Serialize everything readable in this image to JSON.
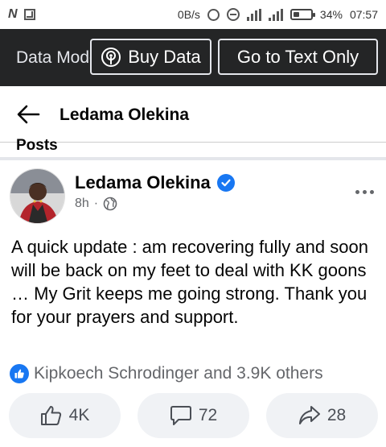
{
  "statusbar": {
    "speed": "0B/s",
    "battery": "34%",
    "time": "07:57",
    "icons": [
      "n-logo-icon",
      "screenshot-icon",
      "sync-icon",
      "dnd-icon",
      "signal-icon",
      "battery-icon"
    ]
  },
  "databar": {
    "mode_label": "Data Mode",
    "buy_data_label": "Buy Data",
    "text_only_label": "Go to Text Only"
  },
  "header": {
    "title": "Ledama Olekina"
  },
  "section": {
    "label": "Posts"
  },
  "post": {
    "author": "Ledama Olekina",
    "time": "8h",
    "separator": "·",
    "text": "A quick update : am recovering fully and soon will be back on my feet to deal with KK goons … My Grit keeps me going strong. Thank you for your prayers and support.",
    "reactions_text": "Kipkoech Schrodinger and 3.9K others",
    "likes": "4K",
    "comments": "72",
    "shares": "28"
  },
  "colors": {
    "brand_blue": "#1877f2",
    "databar_bg": "#242526",
    "button_bg": "#f0f2f5"
  }
}
